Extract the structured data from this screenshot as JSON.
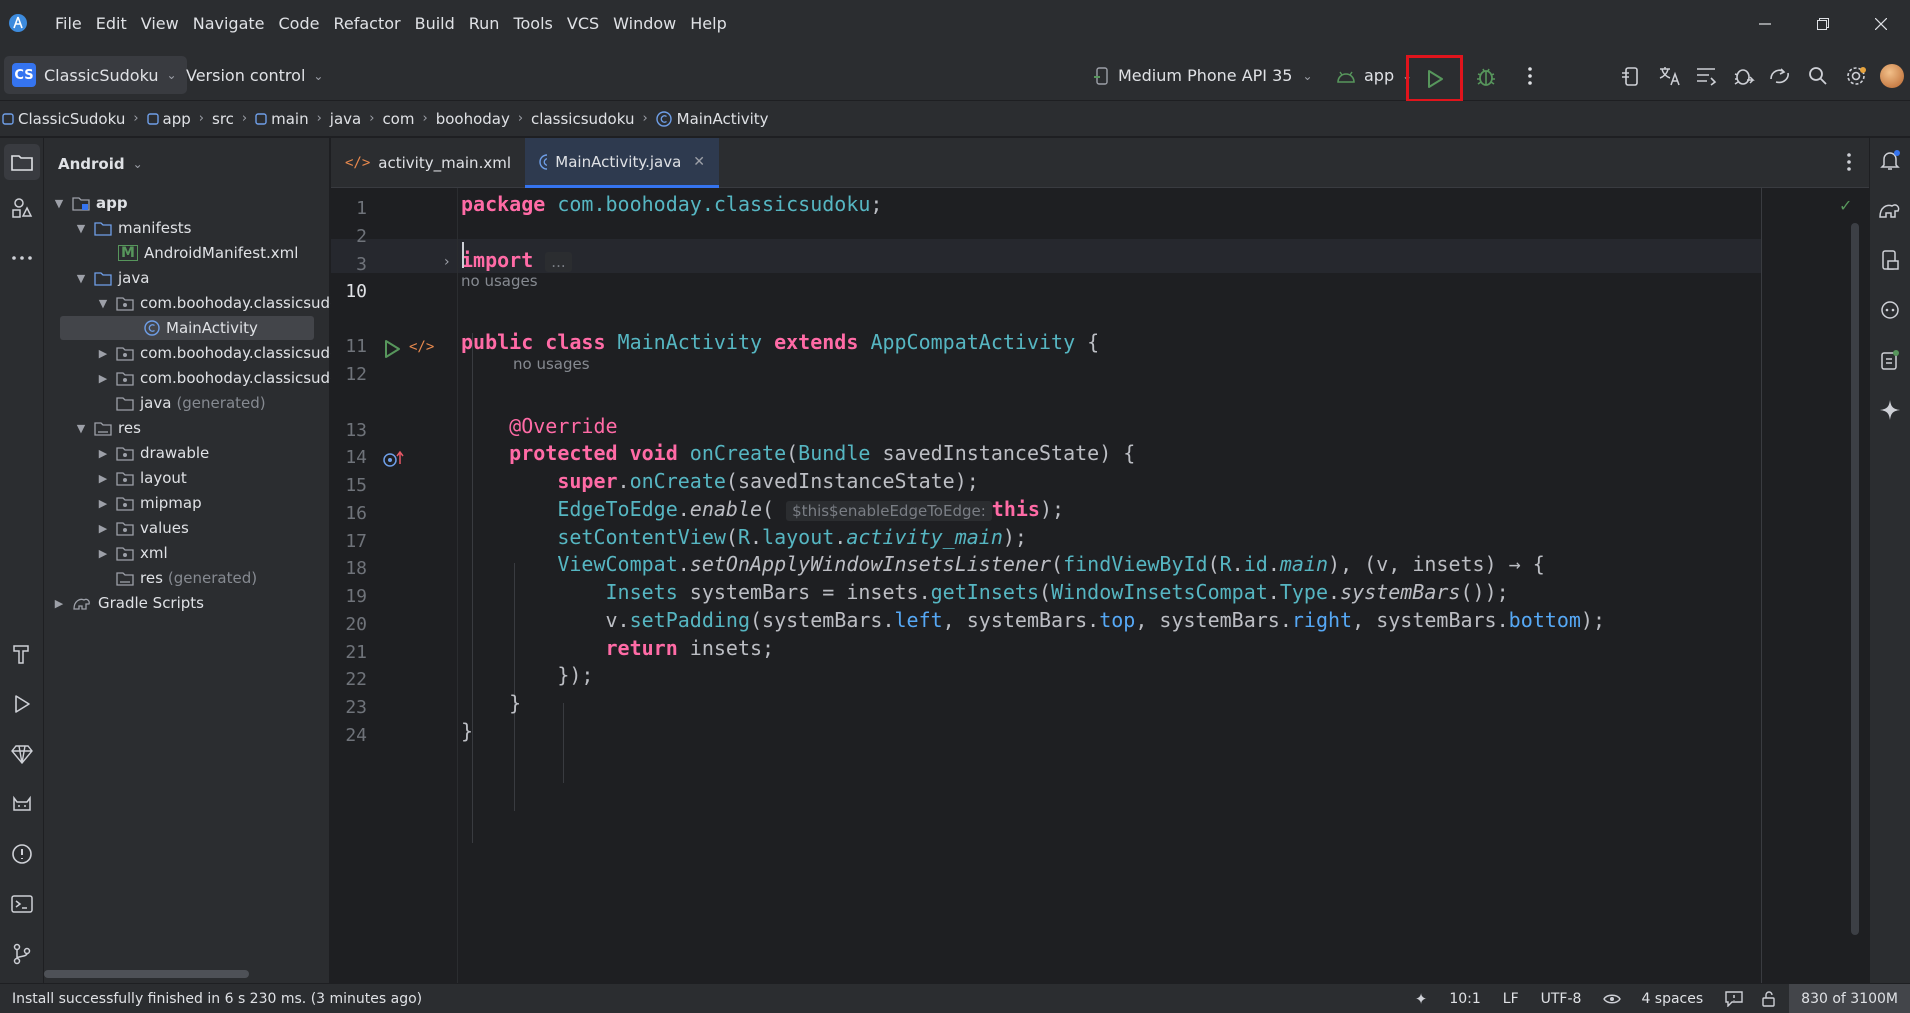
{
  "menu": [
    "File",
    "Edit",
    "View",
    "Navigate",
    "Code",
    "Refactor",
    "Build",
    "Run",
    "Tools",
    "VCS",
    "Window",
    "Help"
  ],
  "toolbar": {
    "project_badge": "CS",
    "project_name": "ClassicSudoku",
    "version_control": "Version control",
    "device": "Medium Phone API 35",
    "run_config": "app"
  },
  "breadcrumbs": [
    "ClassicSudoku",
    "app",
    "src",
    "main",
    "java",
    "com",
    "boohoday",
    "classicsudoku",
    "MainActivity"
  ],
  "project": {
    "view_label": "Android",
    "tree": [
      {
        "label": "app",
        "bold": true
      },
      {
        "label": "manifests"
      },
      {
        "label": "AndroidManifest.xml"
      },
      {
        "label": "java"
      },
      {
        "label": "com.boohoday.classicsudok"
      },
      {
        "label": "MainActivity"
      },
      {
        "label": "com.boohoday.classicsudok"
      },
      {
        "label": "com.boohoday.classicsudok"
      },
      {
        "label": "java",
        "suffix": "(generated)"
      },
      {
        "label": "res"
      },
      {
        "label": "drawable"
      },
      {
        "label": "layout"
      },
      {
        "label": "mipmap"
      },
      {
        "label": "values"
      },
      {
        "label": "xml"
      },
      {
        "label": "res",
        "suffix": "(generated)"
      },
      {
        "label": "Gradle Scripts"
      }
    ]
  },
  "editor": {
    "tabs": [
      {
        "label": "activity_main.xml"
      },
      {
        "label": "MainActivity.java"
      }
    ],
    "line_numbers": [
      "1",
      "2",
      "3",
      "10",
      "11",
      "12",
      "13",
      "14",
      "15",
      "16",
      "17",
      "18",
      "19",
      "20",
      "21",
      "22",
      "23",
      "24"
    ],
    "usage_hint_1": "no usages",
    "usage_hint_2": "no usages",
    "import_fold": "...",
    "inlay_hint": "$this$enableEdgeToEdge:"
  },
  "status": {
    "message": "Install successfully finished in 6 s 230 ms. (3 minutes ago)",
    "position": "10:1",
    "line_sep": "LF",
    "encoding": "UTF-8",
    "indent": "4 spaces",
    "memory": "830 of 3100M"
  },
  "colors": {
    "accent": "#3574f0",
    "run_highlight": "#e0141c",
    "keyword": "#ff6ba6",
    "type": "#56b6c2"
  }
}
